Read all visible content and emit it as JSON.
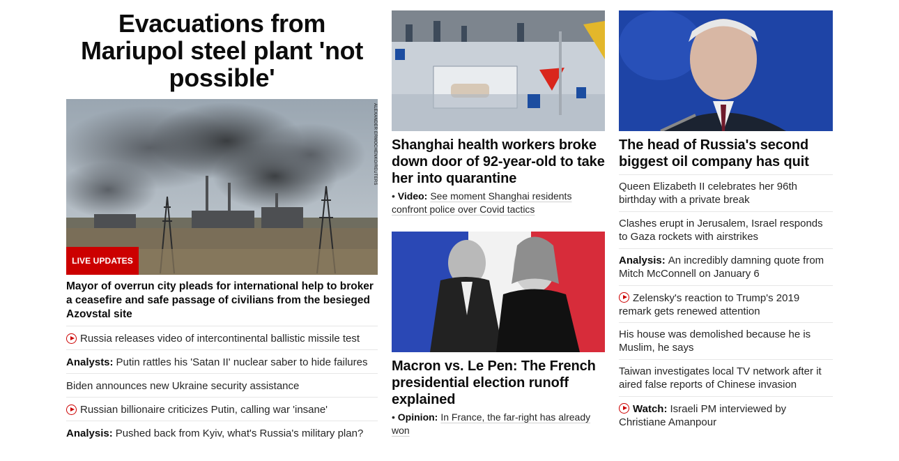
{
  "lead": {
    "headline": "Evacuations from Mariupol steel plant 'not possible'",
    "photo_credit": "ALEXANDER ERMOCHENKO/REUTERS",
    "badge": "LIVE UPDATES",
    "subheadline": "Mayor of overrun city pleads for international help to broker a ceasefire and safe passage of civilians from the besieged Azovstal site",
    "list": [
      {
        "icon": "play-icon",
        "label": "",
        "text": "Russia releases video of intercontinental ballistic missile test"
      },
      {
        "icon": "",
        "label": "Analysts:",
        "text": "Putin rattles his 'Satan II' nuclear saber to hide failures"
      },
      {
        "icon": "",
        "label": "",
        "text": "Biden announces new Ukraine security assistance"
      },
      {
        "icon": "play-icon",
        "label": "",
        "text": "Russian billionaire criticizes Putin, calling war 'insane'"
      },
      {
        "icon": "",
        "label": "Analysis:",
        "text": "Pushed back from Kyiv, what's Russia's military plan?"
      }
    ]
  },
  "shanghai": {
    "title": "Shanghai health workers broke down door of 92-year-old to take her into quarantine",
    "sub_label": "Video:",
    "sub_text": "See moment Shanghai residents confront police over Covid tactics"
  },
  "macron": {
    "title": "Macron vs. Le Pen: The French presidential election runoff explained",
    "sub_label": "Opinion:",
    "sub_text": "In France, the far-right has already won"
  },
  "russia": {
    "title": "The head of Russia's second biggest oil company has quit",
    "list": [
      {
        "icon": "",
        "label": "",
        "text": "Queen Elizabeth II celebrates her 96th birthday with a private break"
      },
      {
        "icon": "",
        "label": "",
        "text": "Clashes erupt in Jerusalem, Israel responds to Gaza rockets with airstrikes"
      },
      {
        "icon": "",
        "label": "Analysis:",
        "text": "An incredibly damning quote from Mitch McConnell on January 6"
      },
      {
        "icon": "play-icon",
        "label": "",
        "text": "Zelensky's reaction to Trump's 2019 remark gets renewed attention"
      },
      {
        "icon": "",
        "label": "",
        "text": "His house was demolished because he is Muslim, he says"
      },
      {
        "icon": "",
        "label": "",
        "text": "Taiwan investigates local TV network after it aired false reports of Chinese invasion"
      },
      {
        "icon": "play-icon",
        "label": "Watch:",
        "text": "Israeli PM interviewed by Christiane Amanpour"
      }
    ]
  },
  "colors": {
    "brand_red": "#cc0000",
    "text": "#0c0c0c",
    "divider": "#e6e6e6"
  }
}
